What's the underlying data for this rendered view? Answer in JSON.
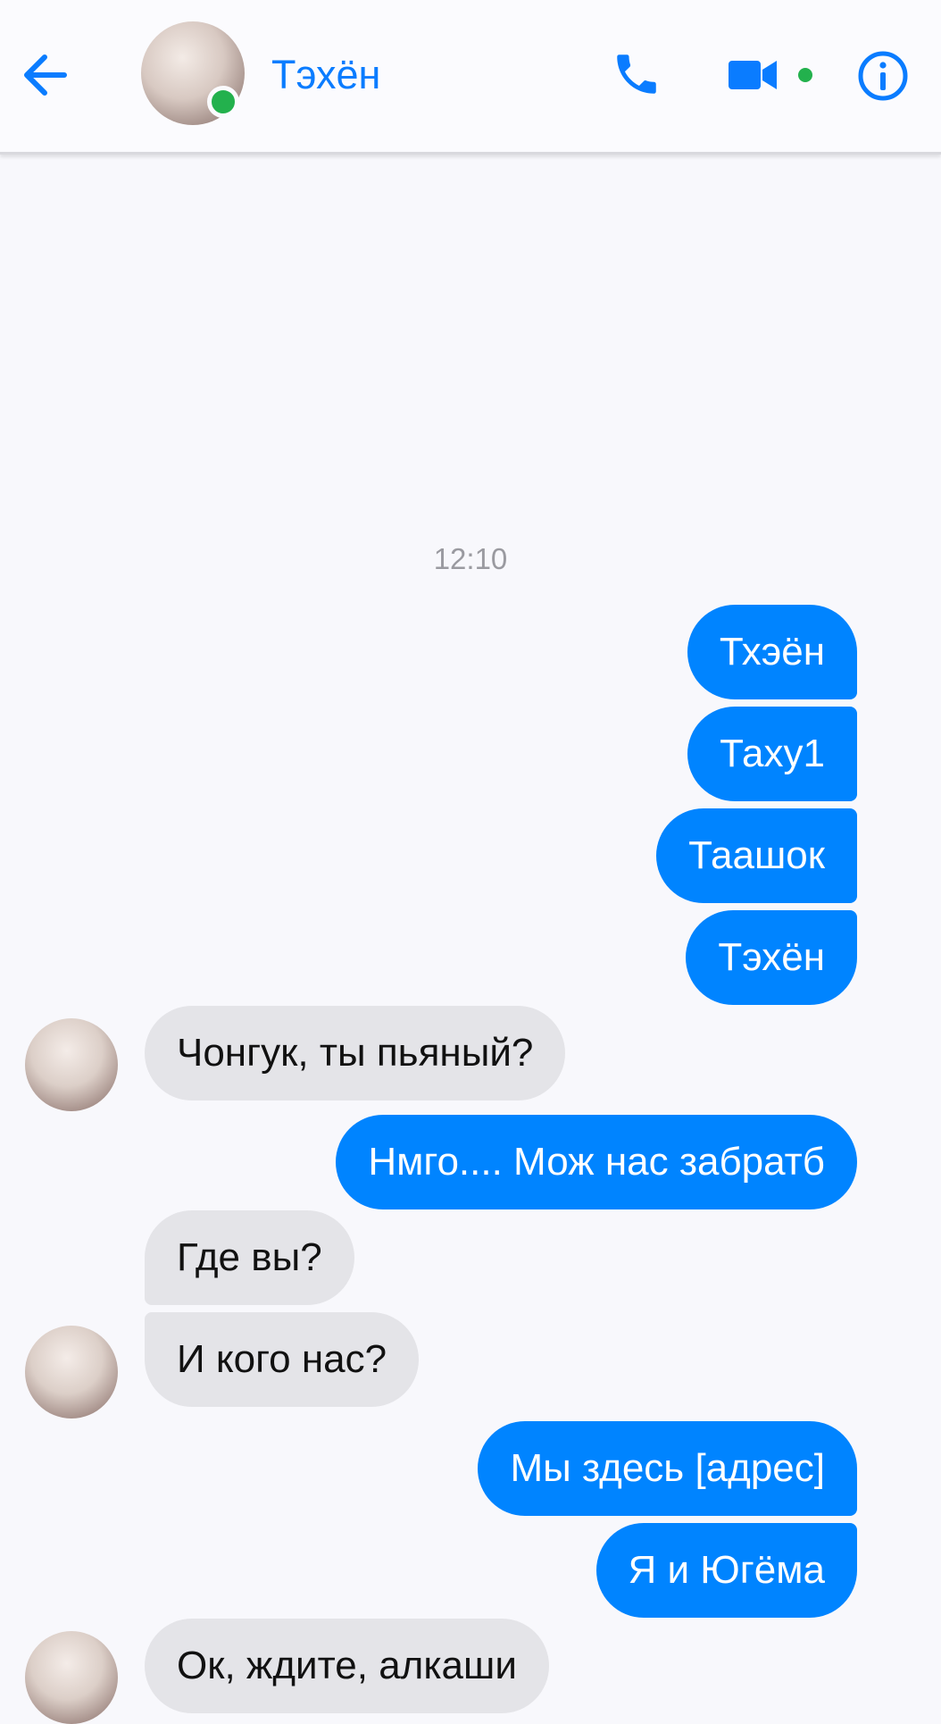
{
  "header": {
    "contact_name": "Тэхён",
    "back_icon": "back-arrow-icon",
    "call_icon": "phone-icon",
    "video_icon": "video-camera-icon",
    "info_icon": "info-icon",
    "accent_color": "#0a7cff",
    "online_color": "#23b14d"
  },
  "chat": {
    "timestamp": "12:10",
    "messages": [
      {
        "direction": "outgoing",
        "text": "Тхэён"
      },
      {
        "direction": "outgoing",
        "text": "Таху1"
      },
      {
        "direction": "outgoing",
        "text": "Таашок"
      },
      {
        "direction": "outgoing",
        "text": "Тэхён"
      },
      {
        "direction": "incoming",
        "text": "Чонгук, ты пьяный?"
      },
      {
        "direction": "outgoing",
        "text": "Нмго.... Мож нас забратб"
      },
      {
        "direction": "incoming",
        "text": "Где вы?"
      },
      {
        "direction": "incoming",
        "text": "И кого нас?"
      },
      {
        "direction": "outgoing",
        "text": "Мы здесь [адрес]"
      },
      {
        "direction": "outgoing",
        "text": "Я и Югёма"
      },
      {
        "direction": "incoming",
        "text": "Ок, ждите, алкаши"
      }
    ],
    "outgoing_color": "#0084ff",
    "incoming_color": "#e4e4e8"
  }
}
